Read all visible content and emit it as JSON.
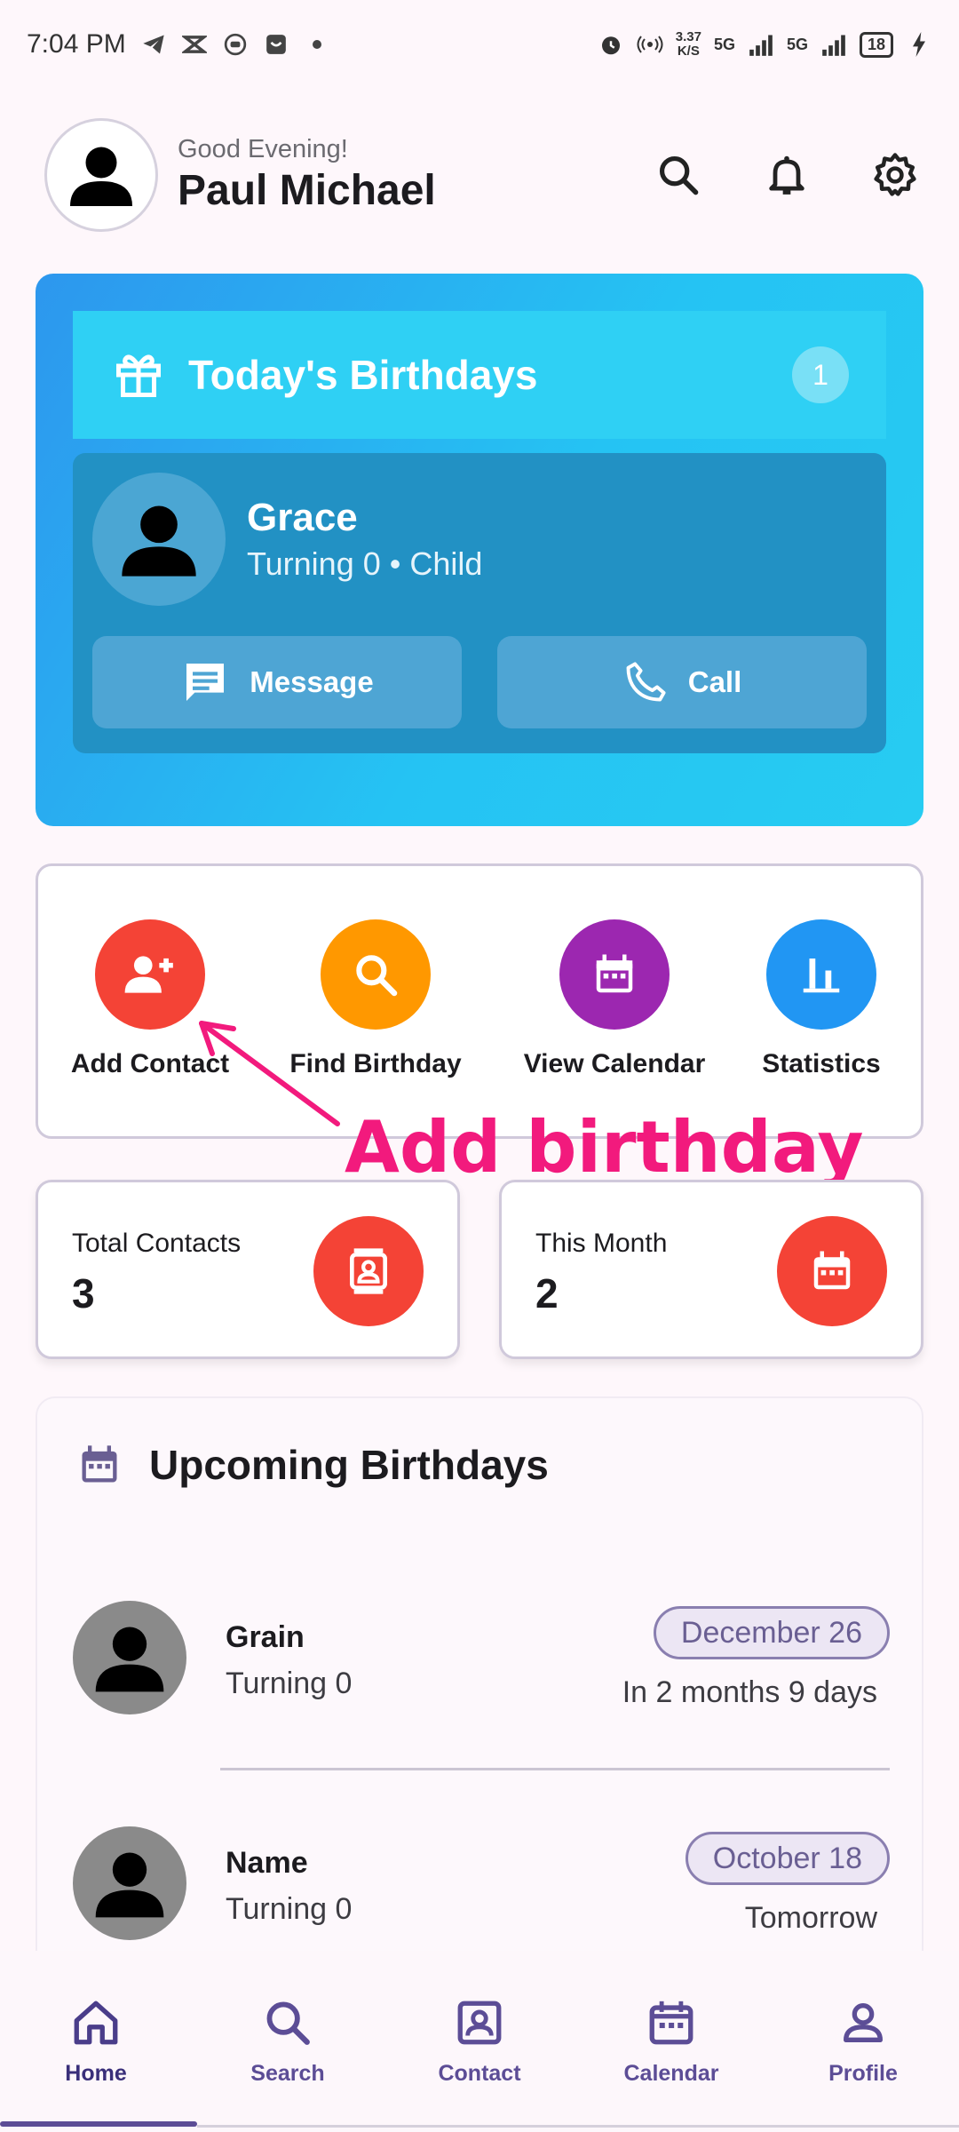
{
  "status_bar": {
    "time": "7:04 PM",
    "net_speed_value": "3.37",
    "net_speed_unit": "K/S",
    "signal1": "5G",
    "signal2": "5G",
    "battery": "18"
  },
  "header": {
    "greeting": "Good Evening!",
    "user_name": "Paul Michael"
  },
  "today_birthdays": {
    "title": "Today's Birthdays",
    "count": "1",
    "person_name": "Grace",
    "person_sub": "Turning 0 • Child",
    "message_label": "Message",
    "call_label": "Call"
  },
  "quick_actions": [
    {
      "label": "Add Contact",
      "color": "#f44336"
    },
    {
      "label": "Find Birthday",
      "color": "#ff9800"
    },
    {
      "label": "View Calendar",
      "color": "#9c27b0"
    },
    {
      "label": "Statistics",
      "color": "#2196f3"
    }
  ],
  "annotation": {
    "text": "Add birthday",
    "color": "#f21a7d"
  },
  "stats": {
    "total_label": "Total Contacts",
    "total_value": "3",
    "month_label": "This Month",
    "month_value": "2"
  },
  "upcoming": {
    "title": "Upcoming Birthdays",
    "items": [
      {
        "name": "Grain",
        "turning": "Turning 0",
        "date": "December 26",
        "relative": "In 2 months 9 days"
      },
      {
        "name": "Name",
        "turning": "Turning 0",
        "date": "October 18",
        "relative": "Tomorrow"
      }
    ]
  },
  "nav": {
    "items": [
      {
        "label": "Home",
        "icon": "home-icon"
      },
      {
        "label": "Search",
        "icon": "search-icon"
      },
      {
        "label": "Contact",
        "icon": "contact-icon"
      },
      {
        "label": "Calendar",
        "icon": "calendar-icon"
      },
      {
        "label": "Profile",
        "icon": "profile-icon"
      }
    ],
    "active": "Home"
  }
}
